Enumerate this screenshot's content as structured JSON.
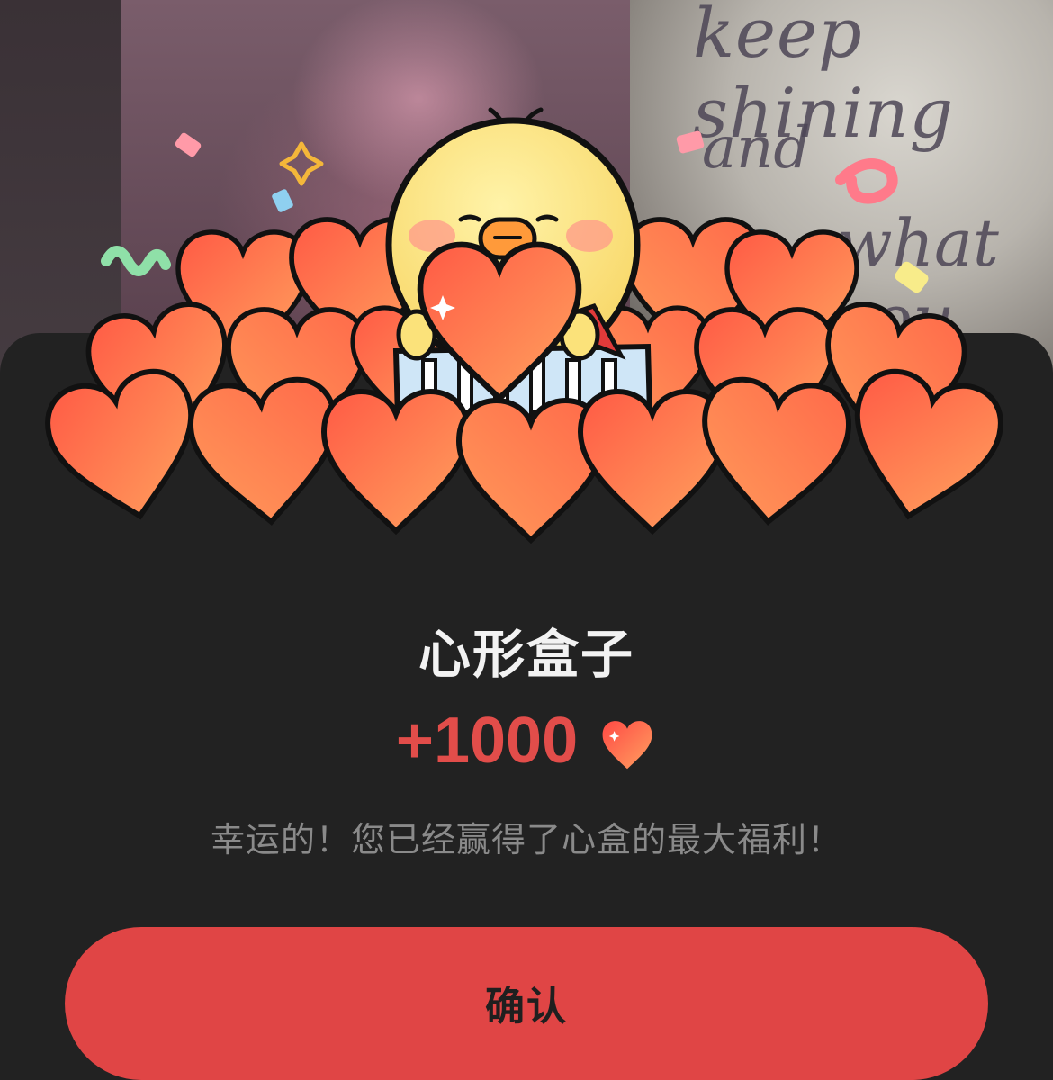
{
  "background": {
    "wall_lines": [
      "keep shining",
      "and",
      "what you"
    ]
  },
  "dialog": {
    "title": "心形盒子",
    "reward_amount": "+1000",
    "reward_icon": "heart-icon",
    "message": "幸运的！您已经赢得了心盒的最大福利！",
    "confirm_label": "确认"
  },
  "colors": {
    "accent": "#e04545",
    "reward_text": "#e24d4a",
    "sheet_background": "#222222",
    "title_text": "#f2f2f2",
    "message_text": "#8a8a8a"
  }
}
